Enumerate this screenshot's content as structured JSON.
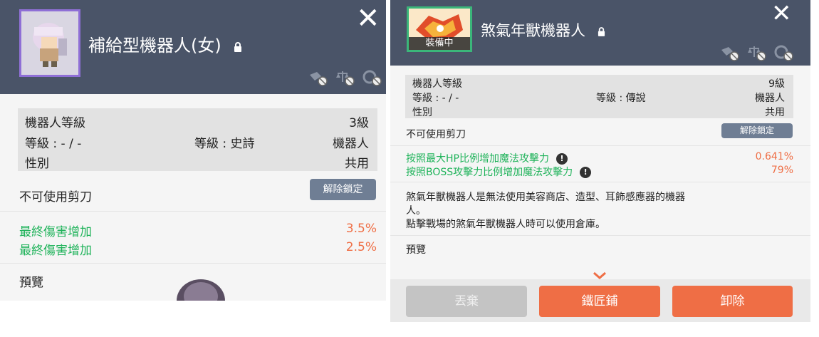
{
  "left": {
    "title": "補給型機器人(女)",
    "stats": {
      "level_label": "機器人等級",
      "level_value": "3級",
      "grade_label": "等級 : - / -",
      "grade_center": "等級 : 史詩",
      "type_value": "機器人",
      "gender_label": "性別",
      "gender_value": "共用"
    },
    "scissors_text": "不可使用剪刀",
    "unlock_button": "解除鎖定",
    "options": [
      {
        "label": "最終傷害增加",
        "value": "3.5%"
      },
      {
        "label": "最終傷害增加",
        "value": "2.5%"
      }
    ],
    "preview_label": "預覽"
  },
  "right": {
    "title": "煞氣年獸機器人",
    "equipped_badge": "裝備中",
    "stats": {
      "level_label": "機器人等級",
      "level_value": "9級",
      "grade_label": "等級 : - / -",
      "grade_center": "等級 : 傳說",
      "type_value": "機器人",
      "gender_label": "性別",
      "gender_value": "共用"
    },
    "scissors_text": "不可使用剪刀",
    "unlock_button": "解除鎖定",
    "options": [
      {
        "label": "按照最大HP比例增加魔法攻擊力",
        "value": "0.641%"
      },
      {
        "label": "按照BOSS攻擊力比例增加魔法攻擊力",
        "value": "79%"
      }
    ],
    "description_line1": "煞氣年獸機器人是無法使用美容商店、造型、耳飾感應器的機器",
    "description_line2": "人。",
    "description_line3": "點擊戰場的煞氣年獸機器人時可以使用倉庫。",
    "preview_label": "預覽",
    "buttons": {
      "discard": "丟棄",
      "blacksmith": "鐵匠鋪",
      "unequip": "卸除"
    }
  },
  "colors": {
    "header": "#4a5468",
    "green": "#1fb35a",
    "orange": "#ef6e45",
    "button_gray": "#bdbdbd",
    "unlock_button": "#6f7e94"
  }
}
